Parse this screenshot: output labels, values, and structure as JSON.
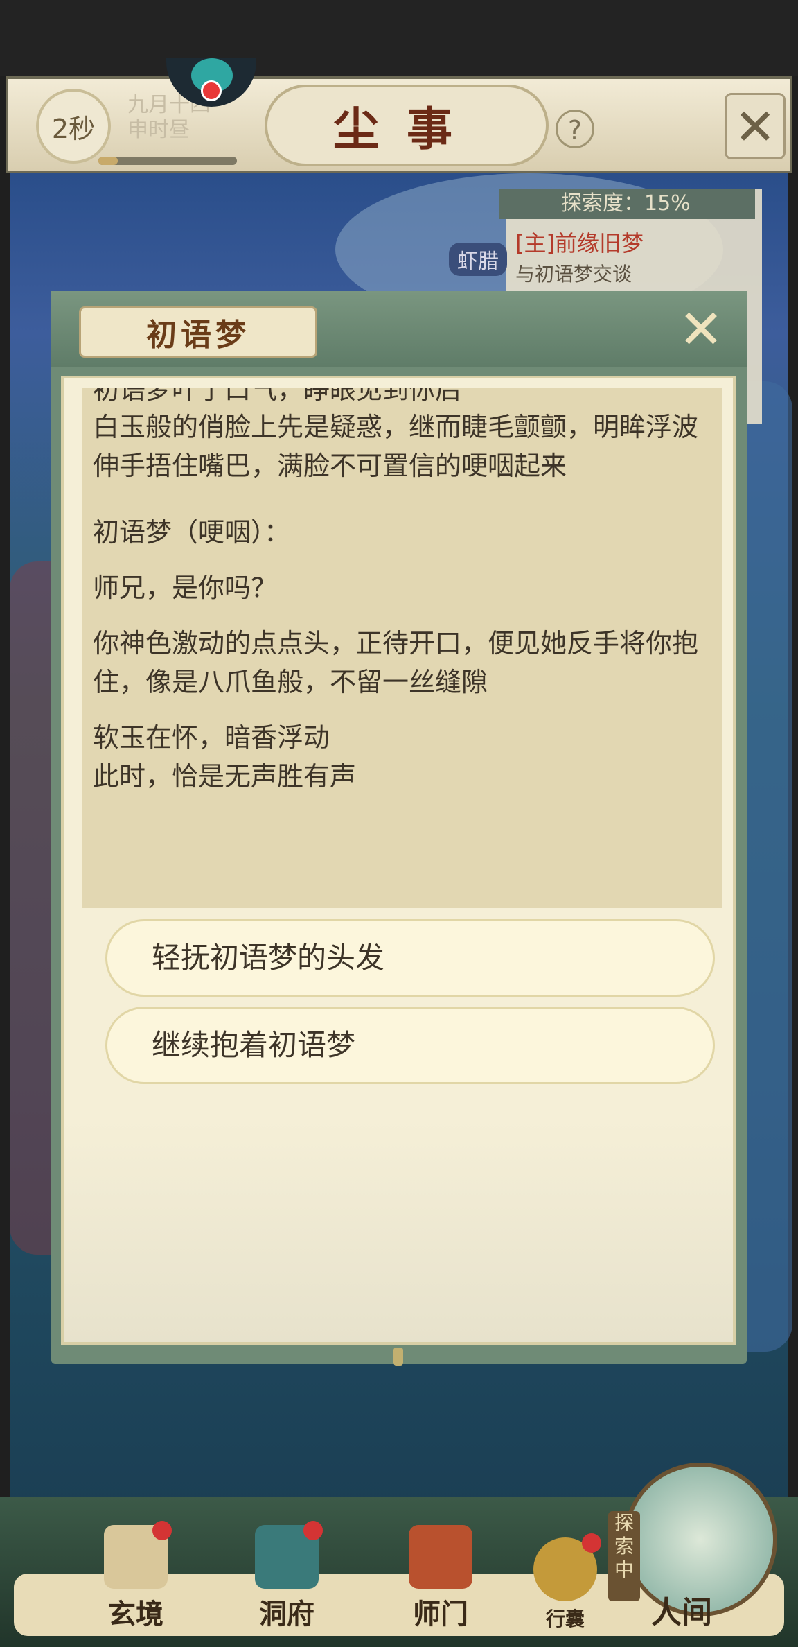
{
  "hud": {
    "timer": "2秒",
    "date_line1": "九月十四",
    "date_line2": "申时昼",
    "title": "尘事",
    "help_symbol": "?",
    "progress_fraction": 0.14
  },
  "map": {
    "explore_label": "探索度：15%",
    "quest_title": "[主]前缘旧梦",
    "quest_subtitle": "与初语梦交谈",
    "shrimp_label": "虾腊"
  },
  "dialog": {
    "speaker": "初语梦",
    "close_symbol": "✕",
    "text_cut": "初语梦叶了口气，睁眼见到你后",
    "paragraphs": [
      "白玉般的俏脸上先是疑惑，继而睫毛颤颤，明眸浮波",
      "伸手捂住嘴巴，满脸不可置信的哽咽起来",
      "初语梦（哽咽）：",
      "师兄，是你吗？",
      "你神色激动的点点头，正待开口，便见她反手将你抱住，像是八爪鱼般，不留一丝缝隙",
      "软玉在怀，暗香浮动",
      "此时，恰是无声胜有声"
    ],
    "choices": [
      "轻抚初语梦的头发",
      "继续抱着初语梦"
    ]
  },
  "nav": {
    "items": [
      {
        "label": "玄境"
      },
      {
        "label": "洞府"
      },
      {
        "label": "师门"
      },
      {
        "label": "行囊"
      }
    ],
    "explore_tag": "探索中",
    "world_label": "人间"
  }
}
